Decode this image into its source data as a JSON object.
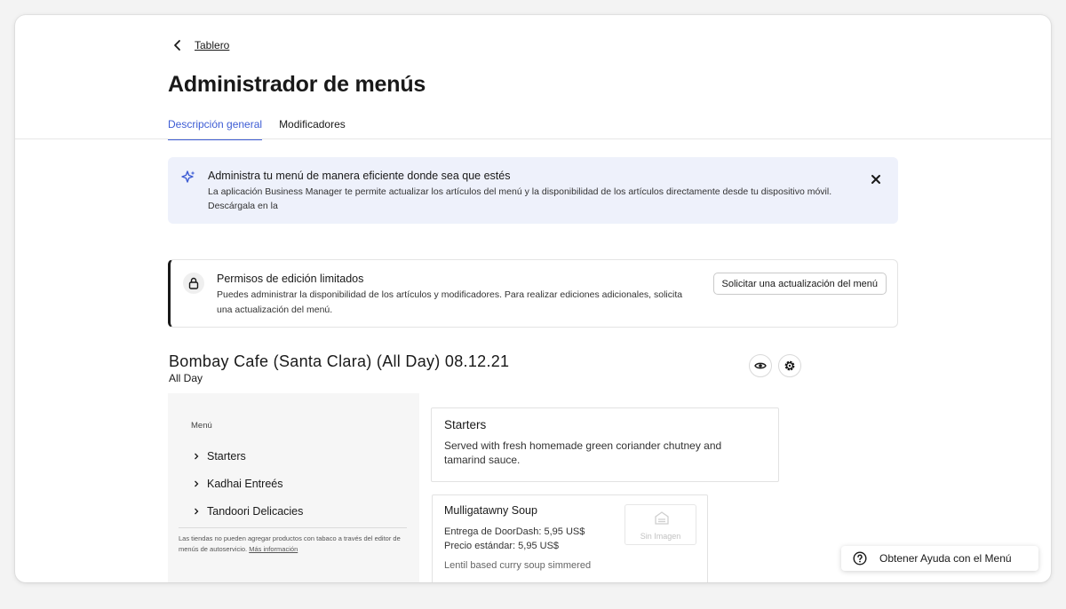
{
  "breadcrumb": {
    "label": "Tablero"
  },
  "page": {
    "title": "Administrador de menús"
  },
  "tabs": [
    {
      "label": "Descripción general",
      "active": true
    },
    {
      "label": "Modificadores",
      "active": false
    }
  ],
  "banner": {
    "title": "Administra tu menú de manera eficiente donde sea que estés",
    "body": "La aplicación Business Manager te permite actualizar los artículos del menú y la disponibilidad de los artículos directamente desde tu dispositivo móvil. Descárgala en la",
    "icon": "sparkle-icon"
  },
  "permissions": {
    "title": "Permisos de edición limitados",
    "body": "Puedes administrar la disponibilidad de los artículos y modificadores. Para realizar ediciones adicionales, solicita una actualización del menú.",
    "button_label": "Solicitar una actualización del menú"
  },
  "menu": {
    "name": "Bombay Cafe (Santa Clara) (All Day) 08.12.21",
    "subtitle": "All Day"
  },
  "sidebar": {
    "heading": "Menú",
    "items": [
      {
        "label": "Starters"
      },
      {
        "label": "Kadhai Entreés"
      },
      {
        "label": "Tandoori Delicacies"
      }
    ],
    "note": "Las tiendas no pueden agregar productos con tabaco a través del editor de menús de autoservicio.",
    "note_link": "Más información"
  },
  "category": {
    "title": "Starters",
    "description": "Served with fresh homemade green coriander chutney and tamarind sauce."
  },
  "item": {
    "title": "Mulligatawny Soup",
    "delivery_price": "Entrega de DoorDash: 5,95 US$",
    "standard_price": "Precio estándar: 5,95 US$",
    "description_partial": "Lentil based curry soup simmered",
    "no_image_label": "Sin Imagen"
  },
  "help": {
    "label": "Obtener Ayuda con el Menú"
  },
  "colors": {
    "accent": "#3d5cd4",
    "banner_bg": "#eef1fb"
  }
}
